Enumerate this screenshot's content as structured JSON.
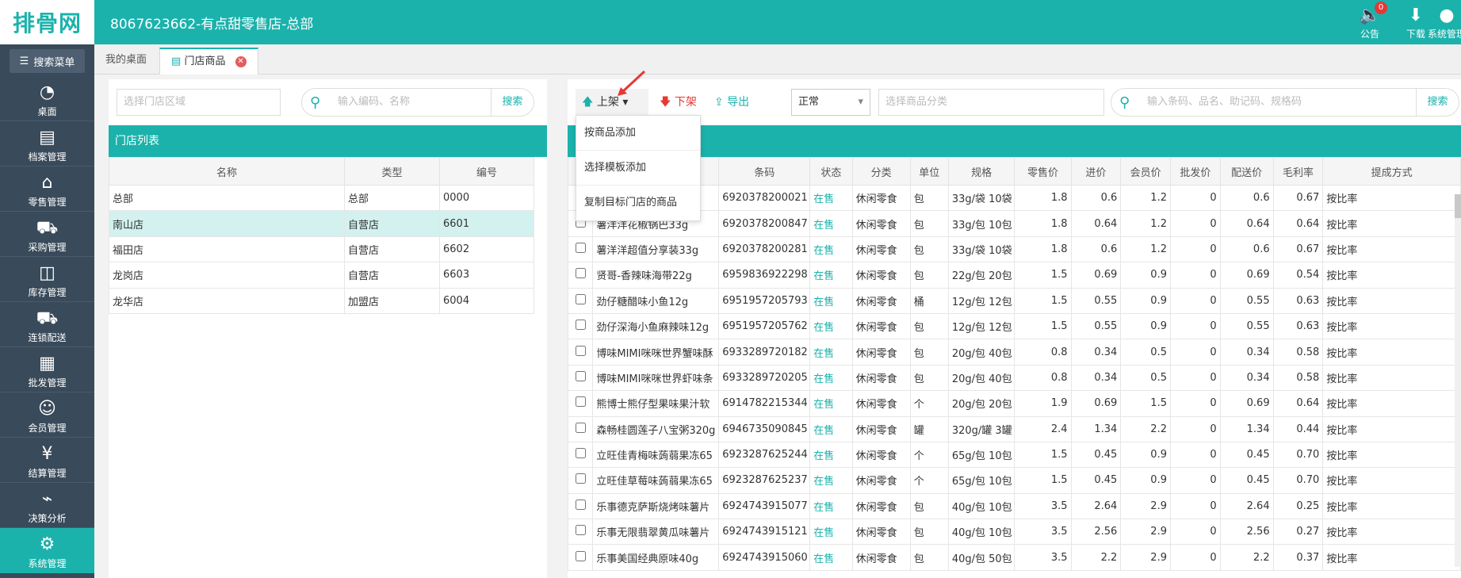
{
  "app": {
    "logo": "排骨网",
    "title": "8067623662-有点甜零售店-总部"
  },
  "topbar": {
    "notice_label": "公告",
    "notice_badge": "0",
    "download_label": "下载",
    "sys_label": "系统管理"
  },
  "sidebar": {
    "search_menu": "搜索菜单",
    "items": [
      {
        "label": "桌面",
        "icon": "dashboard-icon"
      },
      {
        "label": "档案管理",
        "icon": "file-icon"
      },
      {
        "label": "零售管理",
        "icon": "store-icon"
      },
      {
        "label": "采购管理",
        "icon": "cart-icon"
      },
      {
        "label": "库存管理",
        "icon": "inventory-icon"
      },
      {
        "label": "连锁配送",
        "icon": "truck-icon"
      },
      {
        "label": "批发管理",
        "icon": "wholesale-icon"
      },
      {
        "label": "会员管理",
        "icon": "member-icon"
      },
      {
        "label": "结算管理",
        "icon": "settlement-icon"
      },
      {
        "label": "决策分析",
        "icon": "chart-icon"
      },
      {
        "label": "系统管理",
        "icon": "gear-icon"
      }
    ]
  },
  "tabs": [
    {
      "label": "我的桌面"
    },
    {
      "label": "门店商品"
    }
  ],
  "left": {
    "region_placeholder": "选择门店区域",
    "search_placeholder": "输入编码、名称",
    "search_btn": "搜索",
    "section_title": "门店列表",
    "columns": [
      "名称",
      "类型",
      "编号"
    ],
    "rows": [
      [
        "总部",
        "总部",
        "0000"
      ],
      [
        "南山店",
        "自营店",
        "6601"
      ],
      [
        "福田店",
        "自营店",
        "6602"
      ],
      [
        "龙岗店",
        "自营店",
        "6603"
      ],
      [
        "龙华店",
        "加盟店",
        "6004"
      ]
    ]
  },
  "right": {
    "btn_up": "上架",
    "btn_down": "下架",
    "btn_export": "导出",
    "status_select": "正常",
    "category_placeholder": "选择商品分类",
    "search_placeholder": "输入条码、品名、助记码、规格码",
    "search_btn": "搜索",
    "dropdown": [
      "按商品添加",
      "选择模板添加",
      "复制目标门店的商品"
    ],
    "columns": [
      "条码",
      "状态",
      "分类",
      "单位",
      "规格",
      "零售价",
      "进价",
      "会员价",
      "批发价",
      "配送价",
      "毛利率",
      "提成方式"
    ],
    "rows": [
      [
        "",
        "6920378200021",
        "在售",
        "休闲零食",
        "包",
        "33g/袋 10袋",
        "1.8",
        "0.6",
        "1.2",
        "0",
        "0.6",
        "0.67",
        "按比率"
      ],
      [
        "薯洋洋花椒锅巴33g",
        "6920378200847",
        "在售",
        "休闲零食",
        "包",
        "33g/包 10包",
        "1.8",
        "0.64",
        "1.2",
        "0",
        "0.64",
        "0.64",
        "按比率"
      ],
      [
        "薯洋洋超值分享装33g",
        "6920378200281",
        "在售",
        "休闲零食",
        "包",
        "33g/袋 10袋",
        "1.8",
        "0.6",
        "1.2",
        "0",
        "0.6",
        "0.67",
        "按比率"
      ],
      [
        "贤哥-香辣味海带22g",
        "6959836922298",
        "在售",
        "休闲零食",
        "包",
        "22g/包 20包",
        "1.5",
        "0.69",
        "0.9",
        "0",
        "0.69",
        "0.54",
        "按比率"
      ],
      [
        "劲仔糖醋味小鱼12g",
        "6951957205793",
        "在售",
        "休闲零食",
        "桶",
        "12g/包 12包",
        "1.5",
        "0.55",
        "0.9",
        "0",
        "0.55",
        "0.63",
        "按比率"
      ],
      [
        "劲仔深海小鱼麻辣味12g",
        "6951957205762",
        "在售",
        "休闲零食",
        "包",
        "12g/包 12包",
        "1.5",
        "0.55",
        "0.9",
        "0",
        "0.55",
        "0.63",
        "按比率"
      ],
      [
        "博味MIMI咪咪世界蟹味酥",
        "6933289720182",
        "在售",
        "休闲零食",
        "包",
        "20g/包 40包",
        "0.8",
        "0.34",
        "0.5",
        "0",
        "0.34",
        "0.58",
        "按比率"
      ],
      [
        "博味MIMI咪咪世界虾味条",
        "6933289720205",
        "在售",
        "休闲零食",
        "包",
        "20g/包 40包",
        "0.8",
        "0.34",
        "0.5",
        "0",
        "0.34",
        "0.58",
        "按比率"
      ],
      [
        "熊博士熊仔型果味果汁软",
        "6914782215344",
        "在售",
        "休闲零食",
        "个",
        "20g/包 20包",
        "1.9",
        "0.69",
        "1.5",
        "0",
        "0.69",
        "0.64",
        "按比率"
      ],
      [
        "森畅桂圆莲子八宝粥320g",
        "6946735090845",
        "在售",
        "休闲零食",
        "罐",
        "320g/罐 3罐",
        "2.4",
        "1.34",
        "2.2",
        "0",
        "1.34",
        "0.44",
        "按比率"
      ],
      [
        "立旺佳青梅味蒟蒻果冻65",
        "6923287625244",
        "在售",
        "休闲零食",
        "个",
        "65g/包 10包",
        "1.5",
        "0.45",
        "0.9",
        "0",
        "0.45",
        "0.70",
        "按比率"
      ],
      [
        "立旺佳草莓味蒟蒻果冻65",
        "6923287625237",
        "在售",
        "休闲零食",
        "个",
        "65g/包 10包",
        "1.5",
        "0.45",
        "0.9",
        "0",
        "0.45",
        "0.70",
        "按比率"
      ],
      [
        "乐事德克萨斯烧烤味薯片",
        "6924743915077",
        "在售",
        "休闲零食",
        "包",
        "40g/包 10包",
        "3.5",
        "2.64",
        "2.9",
        "0",
        "2.64",
        "0.25",
        "按比率"
      ],
      [
        "乐事无限翡翠黄瓜味薯片",
        "6924743915121",
        "在售",
        "休闲零食",
        "包",
        "40g/包 10包",
        "3.5",
        "2.56",
        "2.9",
        "0",
        "2.56",
        "0.27",
        "按比率"
      ],
      [
        "乐事美国经典原味40g",
        "6924743915060",
        "在售",
        "休闲零食",
        "包",
        "40g/包 50包",
        "3.5",
        "2.2",
        "2.9",
        "0",
        "2.2",
        "0.37",
        "按比率"
      ]
    ]
  },
  "colors": {
    "accent": "#1bb2ac",
    "sidebar": "#394a5a",
    "danger": "#e53935"
  }
}
